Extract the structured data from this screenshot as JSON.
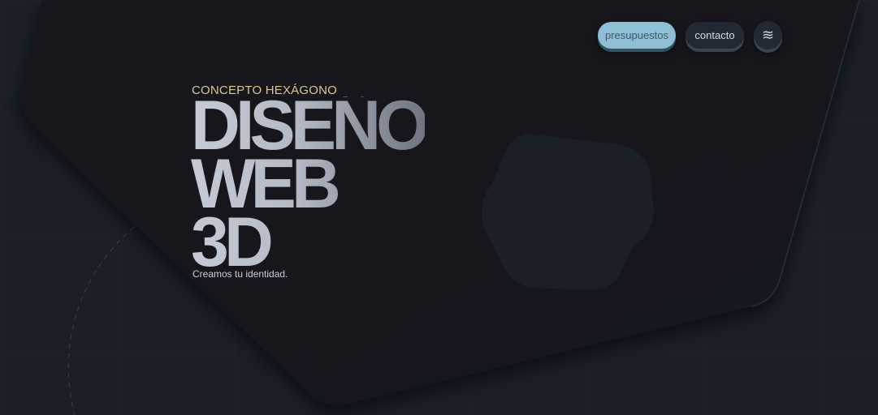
{
  "nav": {
    "quote_label": "presupuestos",
    "contact_label": "contacto",
    "menu_icon": "wave-menu-icon",
    "menu_glyph": "≋"
  },
  "hero": {
    "eyebrow": "CONCEPTO HEXÁGONO",
    "headline_line1": "DISEÑO",
    "headline_line2": "WEB",
    "headline_line3": "3D",
    "tagline": "Creamos tu identidad."
  },
  "colors": {
    "background": "#1a1f28",
    "panel": "#13171d",
    "accent": "#8fbfd6",
    "eyebrow": "#d7c995"
  }
}
